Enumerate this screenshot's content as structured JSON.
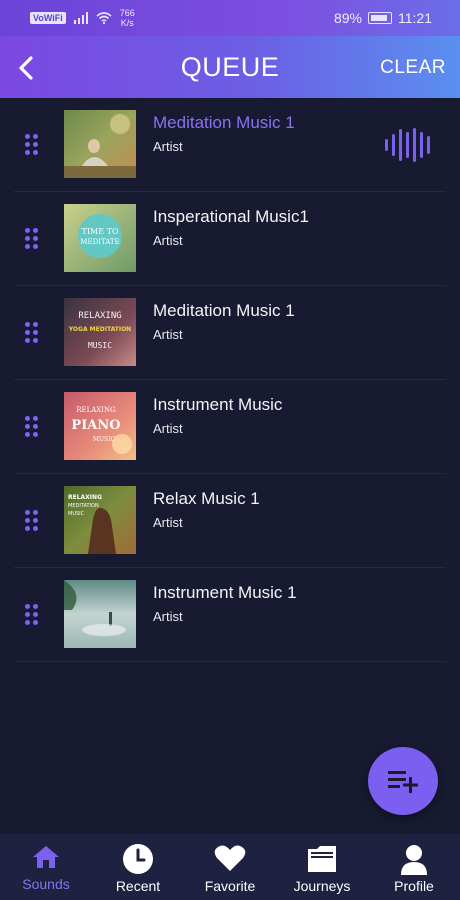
{
  "statusbar": {
    "network_badge": "VoWiFi",
    "speed_value": "766",
    "speed_unit": "K/s",
    "battery": "89%",
    "time": "11:21"
  },
  "header": {
    "title": "QUEUE",
    "clear_label": "CLEAR",
    "back_icon": "chevron-left-icon"
  },
  "queue": [
    {
      "title": "Meditation Music 1",
      "artist": "Artist",
      "playing": true
    },
    {
      "title": "Insperational Music1",
      "artist": "Artist",
      "playing": false
    },
    {
      "title": "Meditation Music 1",
      "artist": "Artist",
      "playing": false
    },
    {
      "title": "Instrument Music",
      "artist": "Artist",
      "playing": false
    },
    {
      "title": "Relax Music 1",
      "artist": "Artist",
      "playing": false
    },
    {
      "title": "Instrument Music 1",
      "artist": "Artist",
      "playing": false
    }
  ],
  "thumb_text": {
    "t2": [
      "TIME TO",
      "MEDITATE"
    ],
    "t3": [
      "RELAXING",
      "YOGA MEDITATION",
      "MUSIC"
    ],
    "t4": [
      "RELAXING",
      "PIANO",
      "MUSIC"
    ],
    "t5": [
      "RELAXING",
      "MEDITATION",
      "MUSIC"
    ]
  },
  "fab": {
    "icon": "add-to-playlist-icon"
  },
  "nav": [
    {
      "label": "Sounds",
      "icon": "home-icon",
      "active": true
    },
    {
      "label": "Recent",
      "icon": "clock-icon",
      "active": false
    },
    {
      "label": "Favorite",
      "icon": "heart-icon",
      "active": false
    },
    {
      "label": "Journeys",
      "icon": "folder-icon",
      "active": false
    },
    {
      "label": "Profile",
      "icon": "user-icon",
      "active": false
    }
  ],
  "colors": {
    "accent": "#7b61ee",
    "background": "#171a30",
    "nav_background": "#1e2140"
  }
}
